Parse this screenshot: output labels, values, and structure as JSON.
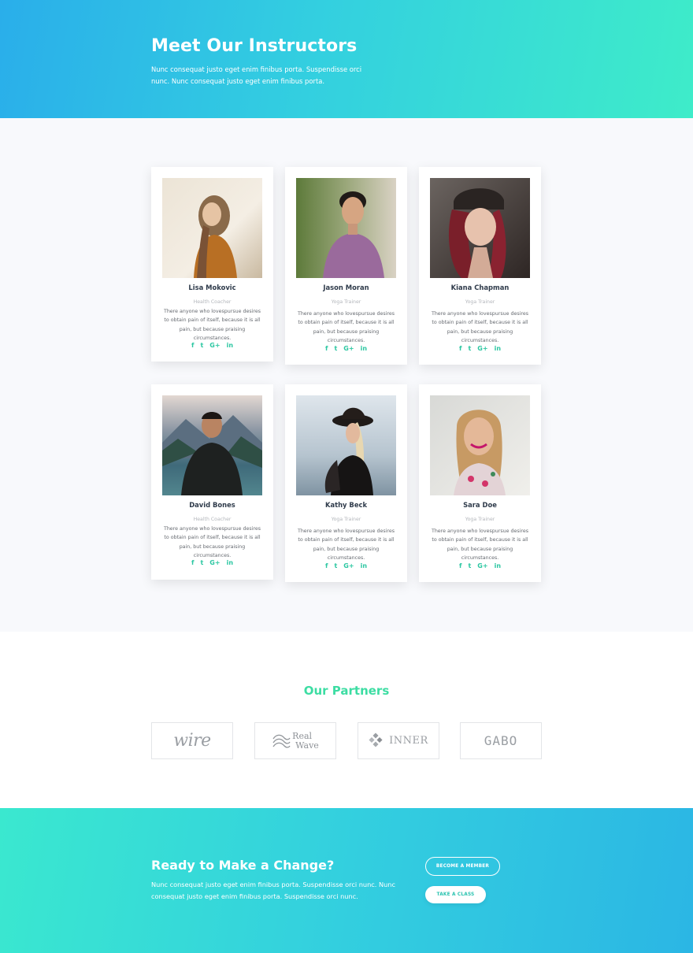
{
  "hero": {
    "title": "Meet Our Instructors",
    "text": "Nunc consequat justo eget enim finibus porta. Suspendisse orci nunc. Nunc consequat justo eget enim finibus porta."
  },
  "instructors": [
    {
      "name": "Lisa Mokovic",
      "role": "Health Coacher",
      "description": "There anyone who lovespursue desires to obtain pain of itself, because it is all pain, but because praising circumstances.",
      "social": [
        "f",
        "t",
        "G+",
        "in"
      ]
    },
    {
      "name": "Jason Moran",
      "role": "Yoga Trainer",
      "description": "There anyone who lovespursue desires to obtain pain of itself, because it is all pain, but because praising circumstances.",
      "social": [
        "f",
        "t",
        "G+",
        "in"
      ]
    },
    {
      "name": "Kiana Chapman",
      "role": "Yoga Trainer",
      "description": "There anyone who lovespursue desires to obtain pain of itself, because it is all pain, but because praising circumstances.",
      "social": [
        "f",
        "t",
        "G+",
        "in"
      ]
    },
    {
      "name": "David Bones",
      "role": "Health Coacher",
      "description": "There anyone who lovespursue desires to obtain pain of itself, because it is all pain, but because praising circumstances.",
      "social": [
        "f",
        "t",
        "G+",
        "in"
      ]
    },
    {
      "name": "Kathy Beck",
      "role": "Yoga Trainer",
      "description": "There anyone who lovespursue desires to obtain pain of itself, because it is all pain, but because praising circumstances.",
      "social": [
        "f",
        "t",
        "G+",
        "in"
      ]
    },
    {
      "name": "Sara Doe",
      "role": "Yoga Trainer",
      "description": "There anyone who lovespursue desires to obtain pain of itself, because it is all pain, but because praising circumstances.",
      "social": [
        "f",
        "t",
        "G+",
        "in"
      ]
    }
  ],
  "partners": {
    "title": "Our Partners",
    "logos": [
      {
        "name": "wire",
        "text": "wire"
      },
      {
        "name": "real-wave",
        "text_line1": "Real",
        "text_line2": "Wave"
      },
      {
        "name": "inner",
        "text": "INNER"
      },
      {
        "name": "gabo",
        "text": "GABO"
      }
    ]
  },
  "cta": {
    "title": "Ready to Make a Change?",
    "text": "Nunc consequat justo eget enim finibus porta. Suspendisse orci nunc. Nunc consequat justo eget enim finibus porta. Suspendisse orci nunc.",
    "member_button": "BECOME A MEMBER",
    "class_button": "TAKE A CLASS"
  },
  "colors": {
    "accent_green": "#3ddda3",
    "social_green": "#2cc7a2",
    "gradient_blue": "#2aaeea",
    "gradient_teal": "#3eecc9"
  },
  "icons": {
    "social": [
      "facebook-icon",
      "twitter-icon",
      "google-plus-icon",
      "linkedin-icon"
    ]
  }
}
